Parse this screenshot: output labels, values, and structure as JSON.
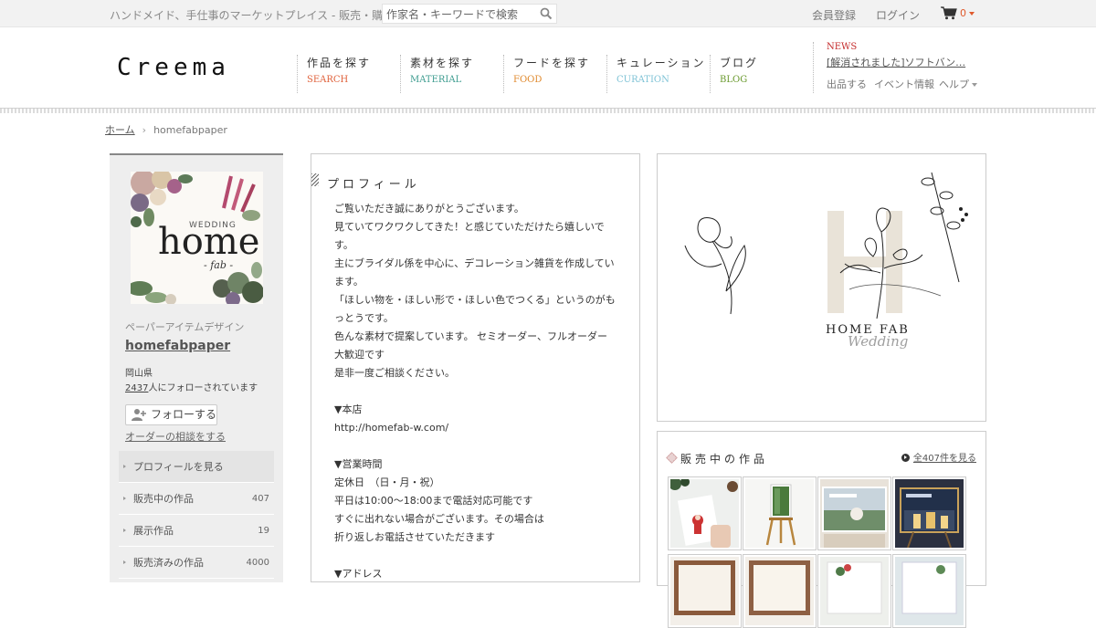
{
  "topbar": {
    "tagline": "ハンドメイド、手仕事のマーケットプレイス - 販売・購入",
    "search_placeholder": "作家名・キーワードで検索",
    "register": "会員登録",
    "login": "ログイン",
    "cart_count": "0"
  },
  "header": {
    "logo": "Creema",
    "nav": [
      {
        "jp": "作品を探す",
        "en": "SEARCH",
        "color": "#e0623c"
      },
      {
        "jp": "素材を探す",
        "en": "MATERIAL",
        "color": "#3d9c8f"
      },
      {
        "jp": "フードを探す",
        "en": "FOOD",
        "color": "#e08a2e"
      },
      {
        "jp": "キュレーション",
        "en": "CURATION",
        "color": "#7fc3d6"
      },
      {
        "jp": "ブログ",
        "en": "BLOG",
        "color": "#6a9a2e"
      }
    ],
    "news_label": "NEWS",
    "news_text": "[解消されました]ソフトバン…",
    "sub_links": [
      "出品する",
      "イベント情報",
      "ヘルプ"
    ]
  },
  "breadcrumb": {
    "home": "ホーム",
    "current": "homefabpaper"
  },
  "sidebar": {
    "category": "ペーパーアイテムデザイン",
    "name": "homefabpaper",
    "prefecture": "岡山県",
    "followers": "2437",
    "followers_suffix": "人にフォローされています",
    "follow_button": "フォローする",
    "order_link": "オーダーの相談をする",
    "avatar_text": {
      "wedding": "WEDDING",
      "home": "home",
      "fab": "- fab -"
    },
    "menu": [
      {
        "label": "プロフィールを見る",
        "count": ""
      },
      {
        "label": "販売中の作品",
        "count": "407"
      },
      {
        "label": "展示作品",
        "count": "19"
      },
      {
        "label": "販売済みの作品",
        "count": "4000"
      }
    ]
  },
  "profile": {
    "title": "プロフィール",
    "lines": [
      "ご覧いただき誠にありがとうございます。",
      "見ていてワクワクしてきた！と感じていただけたら嬉しいで",
      "す。",
      "主にブライダル係を中心に、デコレーション雑貨を作成してい",
      "ます。",
      "「ほしい物を・ほしい形で・ほしい色でつくる」というのがも",
      "っとうです。",
      "色んな素材で提案しています。 セミオーダー、フルオーダー",
      "大歓迎です",
      "是非一度ご相談ください。",
      "",
      "▼本店",
      "http://homefab-w.com/",
      "",
      "▼営業時間",
      "定休日　（日・月・祝）",
      "平日は10:00～18:00まで電話対応可能です",
      "すぐに出れない場合がございます。その場合は",
      "折り返しお電話させていただきます",
      "",
      "▼アドレス"
    ]
  },
  "cover": {
    "letter": "H",
    "brand": "HOME FAB",
    "script": "Wedding"
  },
  "works": {
    "title": "販売中の作品",
    "all_link": "全407件を見る",
    "thumb_names": [
      "christmas-card-thumb",
      "easel-sign-thumb",
      "welcome-board-thumb",
      "night-welcome-board-thumb",
      "frame-sign-thumb-1",
      "frame-sign-thumb-2",
      "frame-sign-thumb-3",
      "frame-sign-thumb-4"
    ]
  }
}
